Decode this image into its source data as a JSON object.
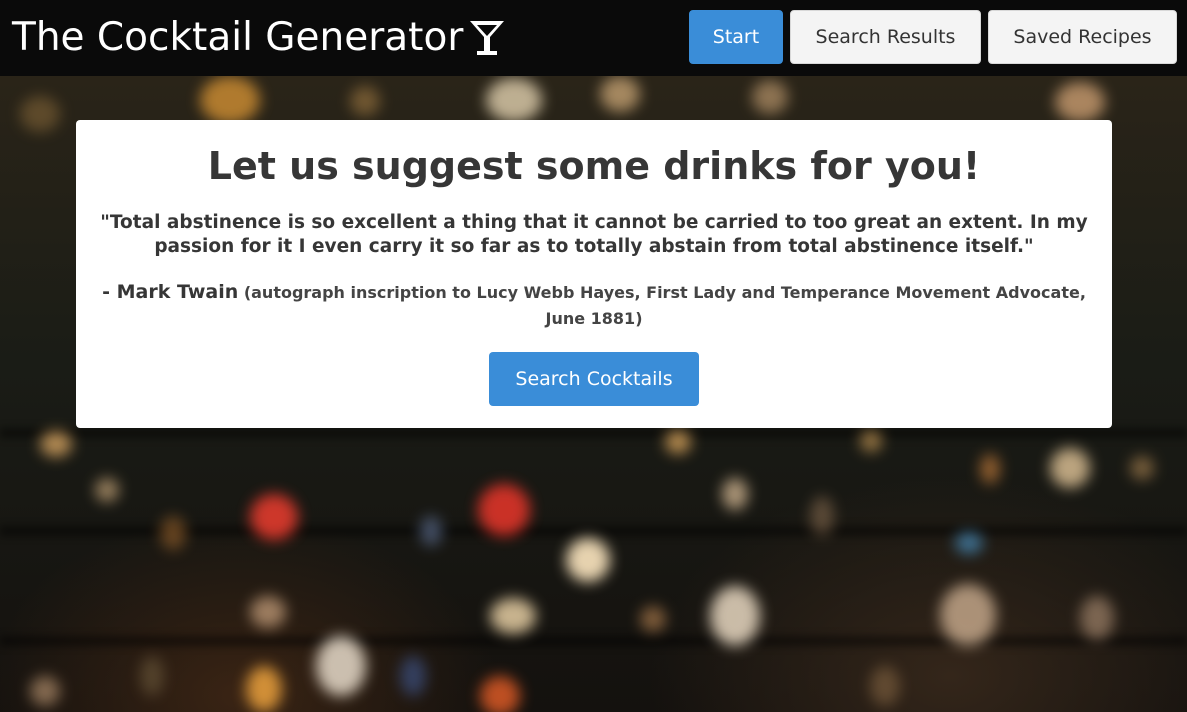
{
  "header": {
    "brand_title": "The Cocktail Generator",
    "brand_icon": "cocktail-glass-icon",
    "nav": {
      "start_label": "Start",
      "results_label": "Search Results",
      "saved_label": "Saved Recipes"
    }
  },
  "hero": {
    "title": "Let us suggest some drinks for you!",
    "quote": "\"Total abstinence is so excellent a thing that it cannot be carried to too great an extent. In my passion for it I even carry it so far as to totally abstain from total abstinence itself.\"",
    "author": "- Mark Twain",
    "source": "(autograph inscription to Lucy Webb Hayes, First Lady and Temperance Movement Advocate, June 1881)",
    "cta_label": "Search Cocktails"
  },
  "colors": {
    "primary": "#3a8dd8",
    "header_bg": "#0a0a0a",
    "card_bg": "#ffffff",
    "text": "#363636"
  }
}
